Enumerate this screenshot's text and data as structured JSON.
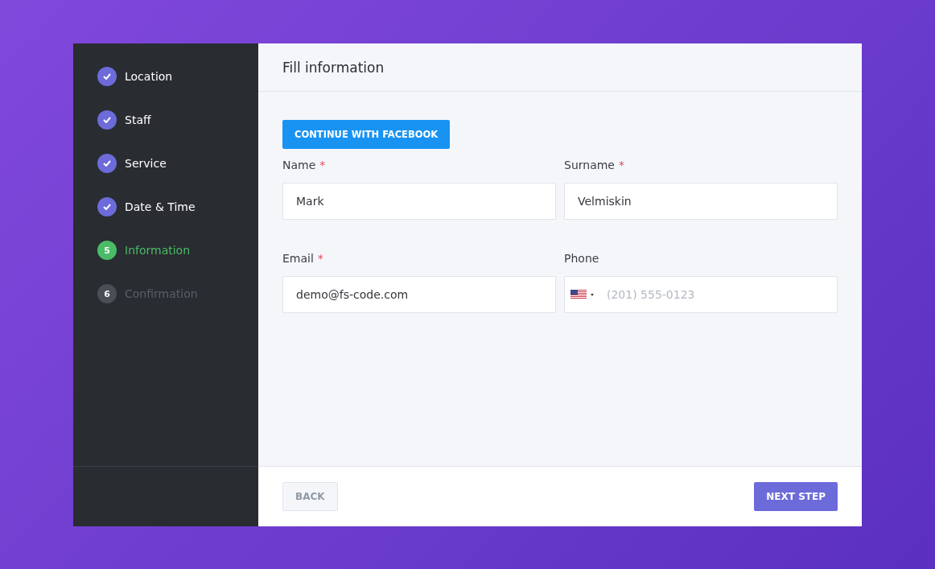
{
  "steps": [
    {
      "label": "Location",
      "kind": "done"
    },
    {
      "label": "Staff",
      "kind": "done"
    },
    {
      "label": "Service",
      "kind": "done"
    },
    {
      "label": "Date & Time",
      "kind": "done"
    },
    {
      "label": "Information",
      "kind": "current",
      "number": "5"
    },
    {
      "label": "Confirmation",
      "kind": "pending",
      "number": "6"
    }
  ],
  "title": "Fill information",
  "facebook_button": "CONTINUE WITH FACEBOOK",
  "fields": [
    {
      "kind": "text",
      "label": "Name",
      "required_mark": "*",
      "value": "Mark"
    },
    {
      "kind": "text",
      "label": "Surname",
      "required_mark": "*",
      "value": "Velmiskin"
    },
    {
      "kind": "text",
      "label": "Email",
      "required_mark": "*",
      "value": "demo@fs-code.com"
    },
    {
      "kind": "phone",
      "label": "Phone",
      "placeholder": "(201) 555-0123"
    }
  ],
  "back_button": {
    "label": "BACK",
    "disabled": true
  },
  "next_button": {
    "label": "NEXT STEP"
  }
}
